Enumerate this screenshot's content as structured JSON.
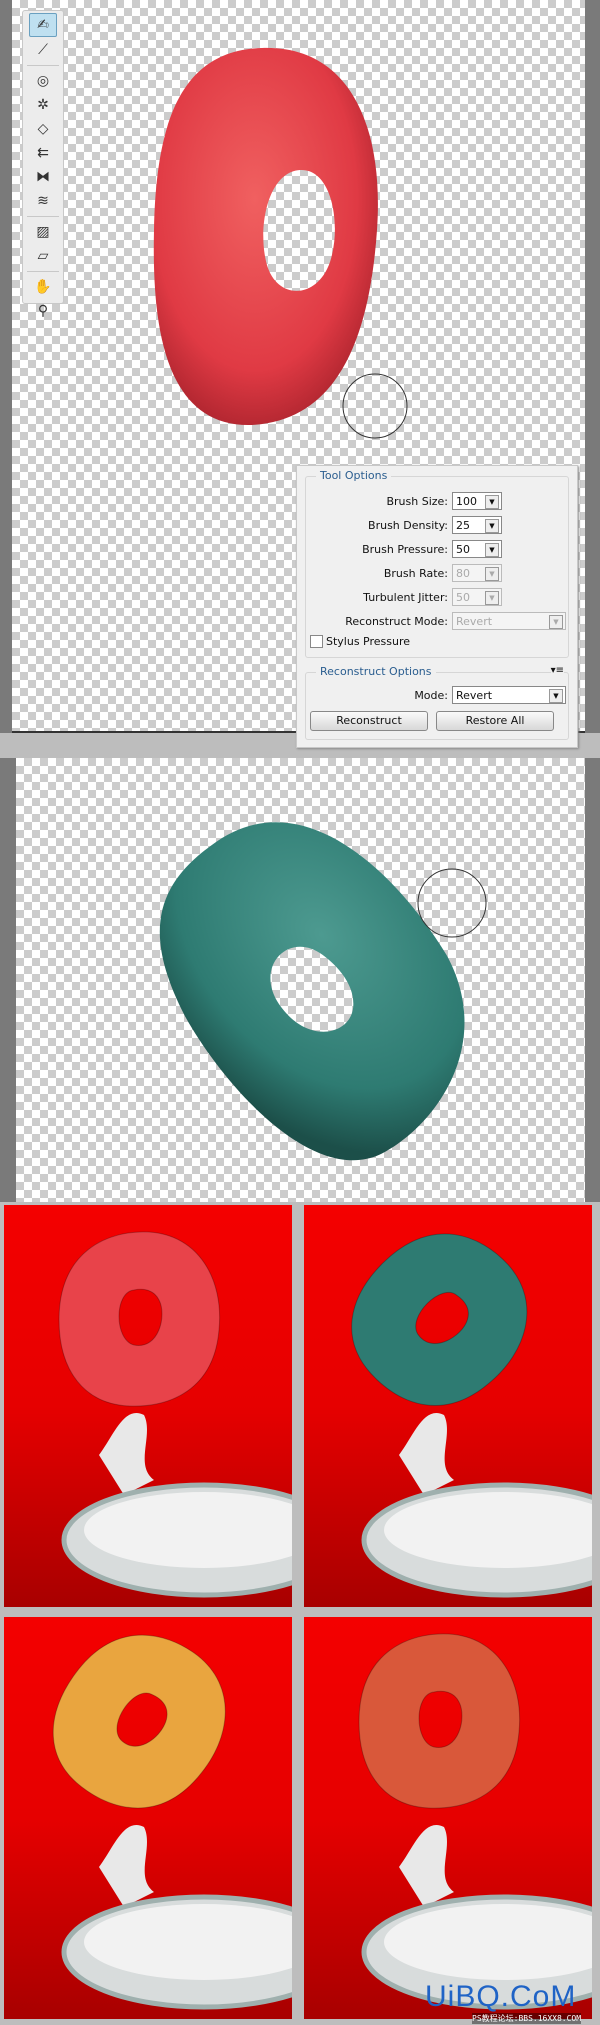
{
  "toolbar": {
    "tools": [
      {
        "icon": "forward-warp-icon",
        "glyph": "✍",
        "active": true
      },
      {
        "icon": "reconstruct-icon",
        "glyph": "⟋"
      },
      {
        "icon": "twirl-icon",
        "glyph": "◎"
      },
      {
        "icon": "pucker-icon",
        "glyph": "✲"
      },
      {
        "icon": "bloat-icon",
        "glyph": "◇"
      },
      {
        "icon": "push-left-icon",
        "glyph": "⇇"
      },
      {
        "icon": "mirror-icon",
        "glyph": "⧓"
      },
      {
        "icon": "turbulence-icon",
        "glyph": "≋"
      },
      {
        "icon": "freeze-mask-icon",
        "glyph": "▨"
      },
      {
        "icon": "thaw-mask-icon",
        "glyph": "▱"
      },
      {
        "icon": "hand-icon",
        "glyph": "✋"
      },
      {
        "icon": "zoom-icon",
        "glyph": "⚲"
      }
    ]
  },
  "tool_options": {
    "title": "Tool Options",
    "brush_size": {
      "label": "Brush Size:",
      "value": "100"
    },
    "brush_density": {
      "label": "Brush Density:",
      "value": "25"
    },
    "brush_pressure": {
      "label": "Brush Pressure:",
      "value": "50"
    },
    "brush_rate": {
      "label": "Brush Rate:",
      "value": "80"
    },
    "turbulent_jitter": {
      "label": "Turbulent Jitter:",
      "value": "50"
    },
    "reconstruct_mode": {
      "label": "Reconstruct Mode:",
      "value": "Revert"
    },
    "stylus_pressure": {
      "label": "Stylus Pressure",
      "checked": false
    }
  },
  "reconstruct_options": {
    "title": "Reconstruct Options",
    "mode": {
      "label": "Mode:",
      "value": "Revert"
    },
    "reconstruct_button": "Reconstruct",
    "restore_all_button": "Restore All"
  },
  "colors": {
    "red_donut": "#e8434a",
    "teal_donut": "#2e7b72",
    "orange_donut": "#e9a53f",
    "coral_donut": "#d9583a",
    "background_red": "#f00000"
  },
  "watermark": {
    "logo": "UiBQ.CoM",
    "site": "PS教程论坛:BBS.16XX8.COM"
  }
}
